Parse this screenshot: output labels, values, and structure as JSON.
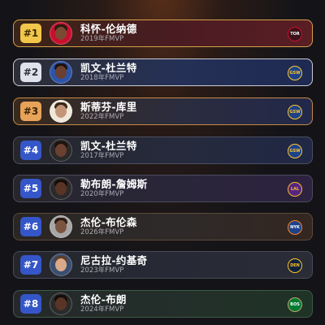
{
  "ranking": [
    {
      "rank": "#1",
      "name": "科怀-伦纳德",
      "season": "2019年FMVP",
      "team": "TOR",
      "row_bg": "linear-gradient(90deg,#3b2418 0%,#4a1c22 55%,#5a1d24 100%)",
      "row_border": "#d4a14a",
      "rank_bg": "#f2c64a",
      "rank_color": "#3a2a00",
      "logo_bg": "#3b1318",
      "logo_color": "#ffffff",
      "logo_border": "#c8102e",
      "skin": "#7a4a33",
      "hair": "#2b1a12",
      "avatar_bg": "#c8102e"
    },
    {
      "rank": "#2",
      "name": "凯文-杜兰特",
      "season": "2018年FMVP",
      "team": "GSW",
      "row_bg": "linear-gradient(90deg,#2d2e36 0%,#253056 55%,#1e2a52 100%)",
      "row_border": "#c9cbd3",
      "rank_bg": "#dfe2ea",
      "rank_color": "#2b2f3a",
      "logo_bg": "#1d428a",
      "logo_color": "#ffc72c",
      "logo_border": "#ffc72c",
      "skin": "#6b4030",
      "hair": "#1d120c",
      "avatar_bg": "#2d54a8"
    },
    {
      "rank": "#3",
      "name": "斯蒂芬-库里",
      "season": "2022年FMVP",
      "team": "GSW",
      "row_bg": "linear-gradient(90deg,#3a2a1c 0%,#2b2c3e 55%,#22284a 100%)",
      "row_border": "#c58a45",
      "rank_bg": "#e7a35a",
      "rank_color": "#3d2304",
      "logo_bg": "#1d428a",
      "logo_color": "#ffc72c",
      "logo_border": "#ffc72c",
      "skin": "#c49678",
      "hair": "#3a2718",
      "avatar_bg": "#f0e8da"
    },
    {
      "rank": "#4",
      "name": "凯文-杜兰特",
      "season": "2017年FMVP",
      "team": "GSW",
      "row_bg": "linear-gradient(90deg,#26262c 0%,#262a3c 55%,#202846 100%)",
      "row_border": "#4c4f60",
      "rank_bg": "#3556c8",
      "rank_color": "#ffffff",
      "logo_bg": "#1d428a",
      "logo_color": "#ffc72c",
      "logo_border": "#ffc72c",
      "skin": "#6b4030",
      "hair": "#1d120c",
      "avatar_bg": "#2a2a2a"
    },
    {
      "rank": "#5",
      "name": "勒布朗-詹姆斯",
      "season": "2020年FMVP",
      "team": "LAL",
      "row_bg": "linear-gradient(90deg,#27262c 0%,#2a263a 55%,#2d2240 100%)",
      "row_border": "#4c4a5c",
      "rank_bg": "#3556c8",
      "rank_color": "#ffffff",
      "logo_bg": "#552583",
      "logo_color": "#fdb927",
      "logo_border": "#fdb927",
      "skin": "#5a3526",
      "hair": "#150d08",
      "avatar_bg": "#2b2b2b"
    },
    {
      "rank": "#6",
      "name": "杰伦-布伦森",
      "season": "2026年FMVP",
      "team": "NYK",
      "row_bg": "linear-gradient(90deg,#2a2623 0%,#2e2a2a 55%,#342620 100%)",
      "row_border": "#5c4a3a",
      "rank_bg": "#3556c8",
      "rank_color": "#ffffff",
      "logo_bg": "#1d428a",
      "logo_color": "#ffffff",
      "logo_border": "#f58426",
      "skin": "#7b5440",
      "hair": "#2a1a10",
      "avatar_bg": "#a7a7a7"
    },
    {
      "rank": "#7",
      "name": "尼古拉-约基奇",
      "season": "2023年FMVP",
      "team": "DEN",
      "row_bg": "linear-gradient(90deg,#25262c 0%,#272a36 55%,#2a2c36 100%)",
      "row_border": "#484b58",
      "rank_bg": "#3556c8",
      "rank_color": "#ffffff",
      "logo_bg": "#0e2240",
      "logo_color": "#fec524",
      "logo_border": "#fec524",
      "skin": "#d9a98a",
      "hair": "#5a3e2a",
      "avatar_bg": "#3a4f70"
    },
    {
      "rank": "#8",
      "name": "杰伦-布朗",
      "season": "2024年FMVP",
      "team": "BOS",
      "row_bg": "linear-gradient(90deg,#24282a 0%,#232f2a 55%,#1f3326 100%)",
      "row_border": "#3e5a46",
      "rank_bg": "#3556c8",
      "rank_color": "#ffffff",
      "logo_bg": "#007a33",
      "logo_color": "#ffffff",
      "logo_border": "#bfa36a",
      "skin": "#5a3526",
      "hair": "#150d08",
      "avatar_bg": "#2b2b2b"
    }
  ]
}
